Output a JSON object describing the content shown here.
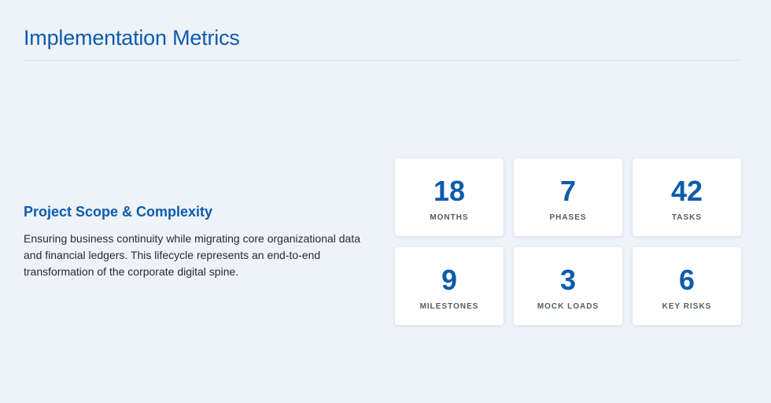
{
  "header": {
    "title": "Implementation Metrics"
  },
  "intro": {
    "title": "Project Scope & Complexity",
    "body": "Ensuring business continuity while migrating core organizational data and financial ledgers. This lifecycle represents an end-to-end transformation of the corporate digital spine."
  },
  "metrics": [
    {
      "value": "18",
      "label": "MONTHS"
    },
    {
      "value": "7",
      "label": "PHASES"
    },
    {
      "value": "42",
      "label": "TASKS"
    },
    {
      "value": "9",
      "label": "MILESTONES"
    },
    {
      "value": "3",
      "label": "MOCK LOADS"
    },
    {
      "value": "6",
      "label": "KEY RISKS"
    }
  ],
  "colors": {
    "accent": "#0b5cad",
    "background": "#eef2f9",
    "card": "#ffffff"
  }
}
